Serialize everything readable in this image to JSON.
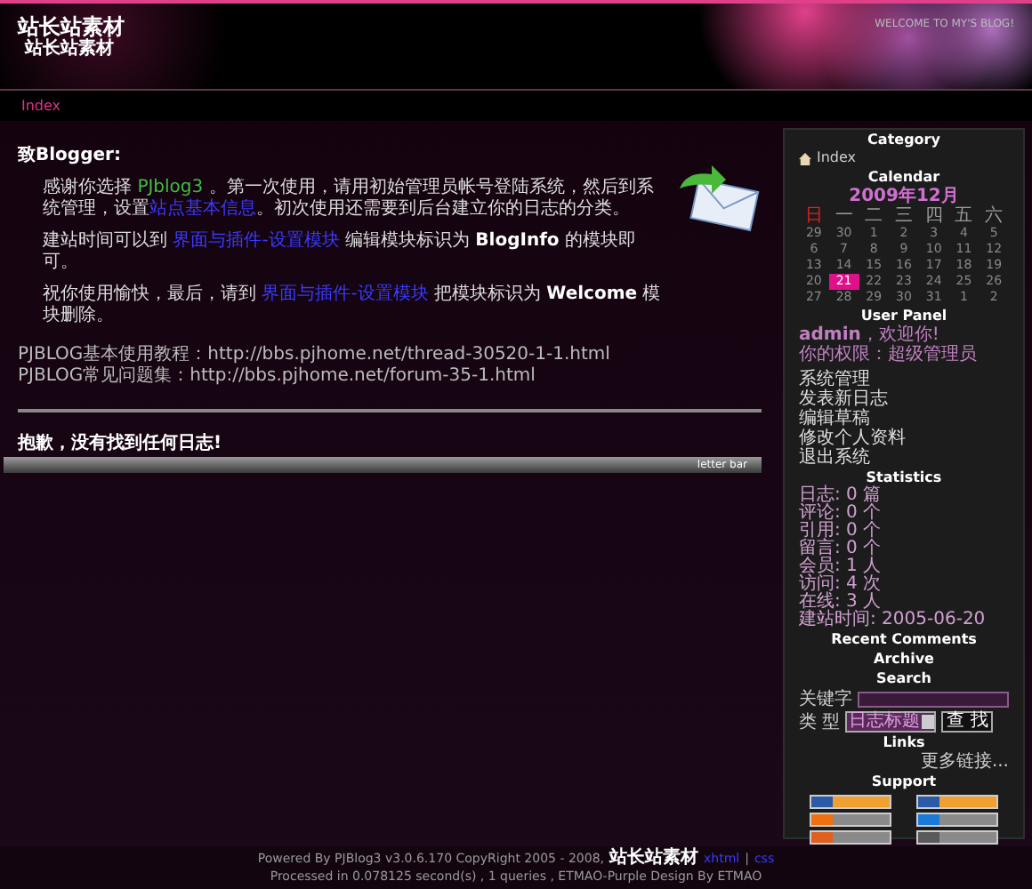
{
  "header": {
    "title": "站长站素材",
    "subtitle": "站长站素材",
    "greeting": "WELCOME TO MY'S BLOG!"
  },
  "nav": [
    {
      "label": "Index",
      "selected": true
    }
  ],
  "welcome": {
    "salutation": "致Blogger:",
    "paragraphs": [
      [
        {
          "kind": "text",
          "text": "感谢你选择 "
        },
        {
          "kind": "brand",
          "text": "PJblog3"
        },
        {
          "kind": "text",
          "text": " 。第一次使用，请用初始管理员帐号登陆系统，然后到系统管理，设置"
        },
        {
          "kind": "link",
          "text": "站点基本信息"
        },
        {
          "kind": "text",
          "text": "。初次使用还需要到后台建立你的日志的分类。"
        }
      ],
      [
        {
          "kind": "text",
          "text": "建站时间可以到 "
        },
        {
          "kind": "link",
          "text": "界面与插件-设置模块"
        },
        {
          "kind": "text",
          "text": " 编辑模块标识为 "
        },
        {
          "kind": "strong",
          "text": "BlogInfo"
        },
        {
          "kind": "text",
          "text": " 的模块即可。"
        }
      ],
      [
        {
          "kind": "text",
          "text": "祝你使用愉快，最后，请到 "
        },
        {
          "kind": "link",
          "text": "界面与插件-设置模块"
        },
        {
          "kind": "text",
          "text": " 把模块标识为 "
        },
        {
          "kind": "strong",
          "text": "Welcome"
        },
        {
          "kind": "text",
          "text": " 模块删除。"
        }
      ]
    ],
    "links": [
      "PJBLOG基本使用教程：http://bbs.pjhome.net/thread-30520-1-1.html",
      "PJBLOG常见问题集：http://bbs.pjhome.net/forum-35-1.html"
    ]
  },
  "notice": "抱歉，没有找到任何日志!",
  "bar_label": "letter bar",
  "category": {
    "title": "Category",
    "items": [
      "Index"
    ]
  },
  "calendar": {
    "title": "Calendar",
    "month": "2009年12月",
    "weekdays": [
      {
        "label": "日",
        "color": "#e02020"
      },
      {
        "label": "一",
        "color": "#9a9a9a"
      },
      {
        "label": "二",
        "color": "#9a9a9a"
      },
      {
        "label": "三",
        "color": "#9a9a9a"
      },
      {
        "label": "四",
        "color": "#9a9a9a"
      },
      {
        "label": "五",
        "color": "#9a9a9a"
      },
      {
        "label": "六",
        "color": "#9a9a9a"
      }
    ],
    "weeks": [
      [
        {
          "day": "29",
          "selected": false
        },
        {
          "day": "30",
          "selected": false
        },
        {
          "day": "1",
          "selected": false
        },
        {
          "day": "2",
          "selected": false
        },
        {
          "day": "3",
          "selected": false
        },
        {
          "day": "4",
          "selected": false
        },
        {
          "day": "5",
          "selected": false
        }
      ],
      [
        {
          "day": "6",
          "selected": false
        },
        {
          "day": "7",
          "selected": false
        },
        {
          "day": "8",
          "selected": false
        },
        {
          "day": "9",
          "selected": false
        },
        {
          "day": "10",
          "selected": false
        },
        {
          "day": "11",
          "selected": false
        },
        {
          "day": "12",
          "selected": false
        }
      ],
      [
        {
          "day": "13",
          "selected": false
        },
        {
          "day": "14",
          "selected": false
        },
        {
          "day": "15",
          "selected": false
        },
        {
          "day": "16",
          "selected": false
        },
        {
          "day": "17",
          "selected": false
        },
        {
          "day": "18",
          "selected": false
        },
        {
          "day": "19",
          "selected": false
        }
      ],
      [
        {
          "day": "20",
          "selected": false
        },
        {
          "day": "21",
          "selected": true
        },
        {
          "day": "22",
          "selected": false
        },
        {
          "day": "23",
          "selected": false
        },
        {
          "day": "24",
          "selected": false
        },
        {
          "day": "25",
          "selected": false
        },
        {
          "day": "26",
          "selected": false
        }
      ],
      [
        {
          "day": "27",
          "selected": false
        },
        {
          "day": "28",
          "selected": false
        },
        {
          "day": "29",
          "selected": false
        },
        {
          "day": "30",
          "selected": false
        },
        {
          "day": "31",
          "selected": false
        },
        {
          "day": "1",
          "selected": false
        },
        {
          "day": "2",
          "selected": false
        }
      ]
    ]
  },
  "user_panel": {
    "title": "User Panel",
    "greeting": "**admin**，欢迎你!",
    "role": "你的权限：超级管理员",
    "links": [
      "系统管理",
      "发表新日志",
      "编辑草稿",
      "修改个人资料",
      "退出系统"
    ]
  },
  "statistics": {
    "title": "Statistics",
    "lines": [
      "日志: 0 篇",
      "评论: 0 个",
      "引用: 0 个",
      "留言: 0 个",
      "会员: 1 人",
      "访问: 4 次",
      "在线: 3 人",
      "建站时间: 2005-06-20"
    ]
  },
  "recent_comments": {
    "title": "Recent Comments"
  },
  "archive": {
    "title": "Archive"
  },
  "search": {
    "title": "Search",
    "keyword_label": "关键字",
    "type_label": "类 型",
    "type_value": "日志标题",
    "button": "查 找"
  },
  "links": {
    "title": "Links",
    "more": "更多链接..."
  },
  "support": {
    "title": "Support",
    "badges": [
      {
        "kind": "w3c"
      },
      {
        "kind": "w3c"
      },
      {
        "kind": "orange"
      },
      {
        "kind": "blue"
      },
      {
        "kind": "feed"
      },
      {
        "kind": "grey"
      }
    ]
  },
  "footer": {
    "lines": [
      [
        {
          "kind": "text",
          "text": "Powered By PJBlog3 v3.0.6.170 CopyRight 2005 - 2008,"
        },
        {
          "kind": "strong",
          "text": "站长站素材"
        },
        {
          "kind": "link",
          "text": "xhtml"
        },
        {
          "kind": "text",
          "text": "|"
        },
        {
          "kind": "link",
          "text": "css"
        }
      ],
      [
        {
          "kind": "text",
          "text": "Processed in 0.078125 second(s) , 1 queries , ETMAO-Purple Design By ETMAO"
        }
      ]
    ]
  }
}
